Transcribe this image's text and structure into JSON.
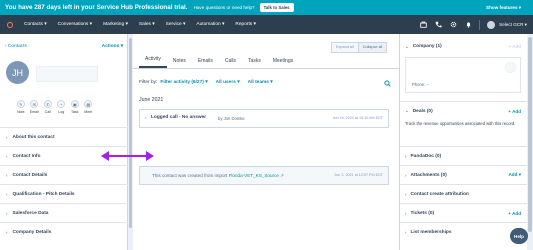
{
  "trial_bar": {
    "message": "You have 287 days left in your Service Hub Professional trial.",
    "help_text": "Have questions or need help?",
    "talk_button": "Talk to Sales",
    "show_features": "Show features ▾"
  },
  "nav": {
    "items": [
      "Contacts ▾",
      "Conversations ▾",
      "Marketing ▾",
      "Sales ▾",
      "Service ▾",
      "Automation ▾",
      "Reports ▾"
    ],
    "account": "Select GCR ▾"
  },
  "left": {
    "back_link": "‹ Contacts",
    "actions": "Actions ▾",
    "avatar_initials": "JH",
    "action_icons": [
      {
        "label": "Note",
        "icon": "✎"
      },
      {
        "label": "Email",
        "icon": "✉"
      },
      {
        "label": "Call",
        "icon": "✆"
      },
      {
        "label": "Log",
        "icon": "+"
      },
      {
        "label": "Task",
        "icon": "▣"
      },
      {
        "label": "Meet",
        "icon": "▦"
      }
    ],
    "sections": [
      "About this contact",
      "Contact Info",
      "Contact Details",
      "Qualification - Pitch Details",
      "Salesforce Data",
      "Company Details"
    ]
  },
  "center": {
    "expand_all": "Expand all",
    "collapse_all": "Collapse all",
    "tabs": [
      "Activity",
      "Notes",
      "Emails",
      "Calls",
      "Tasks",
      "Meetings"
    ],
    "filter_label": "Filter by:",
    "filter_activity": "Filter activity (6/27) ▾",
    "filter_users": "All users ▾",
    "filter_teams": "All teams ▾",
    "month": "June 2021",
    "activity1": {
      "title": "Logged call - No answer",
      "by": "by Jon Domke",
      "date": "Jun 16, 2021 at 10:10 AM EDT"
    },
    "activity2": {
      "text": "This contact was created from import",
      "link": "Florida-VET_KS_Source ↗",
      "date": "Jun 3, 2021 at 12:07 PM EDT"
    }
  },
  "right": {
    "company": {
      "label": "Company (1)",
      "add": "+ Add",
      "phone": "Phone: --"
    },
    "deals": {
      "label": "Deals (0)",
      "add": "+ Add",
      "text": "Track the revenue opportunities associated with this record."
    },
    "pandadoc": {
      "label": "PandaDoc (0)"
    },
    "attachments": {
      "label": "Attachments (0)",
      "add": "Add ▾"
    },
    "contact_attribution": {
      "label": "Contact create attribution"
    },
    "tickets": {
      "label": "Tickets (0)",
      "add": "+ Add"
    },
    "list_memberships": {
      "label": "List memberships",
      "add": "Ma"
    },
    "help": "Help"
  },
  "colors": {
    "trial_bar": "#00a4bd",
    "nav": "#2d3e50",
    "link": "#0091ae",
    "annotation_arrow": "#a020f0"
  }
}
